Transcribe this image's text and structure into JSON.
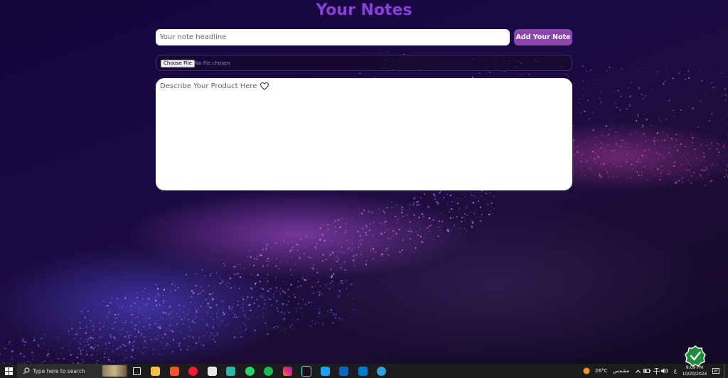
{
  "page": {
    "title": "Your Notes",
    "headline_placeholder": "Your note headline",
    "add_button_label": "Add Your Note",
    "file_button_label": "Choose File",
    "file_status": "No file chosen",
    "description_placeholder": "Describe Your Product Here",
    "colors": {
      "title": "#8a3fd8",
      "button": "#8e44ad",
      "file_status": "#9b7bd0"
    }
  },
  "taskbar": {
    "search_placeholder": "Type here to search",
    "apps": [
      "task-view-icon",
      "file-explorer-icon",
      "brave-icon",
      "opera-icon",
      "store-icon",
      "app-icon",
      "whatsapp-icon",
      "spotify-icon",
      "instagram-icon",
      "tiktok-icon",
      "twitter-icon",
      "linkedin-icon",
      "vscode-icon",
      "telegram-icon"
    ],
    "weather_temp": "26°C",
    "weather_text": "مشمس",
    "language": "ع",
    "time": "9:09 PM",
    "date": "10/20/2024"
  }
}
